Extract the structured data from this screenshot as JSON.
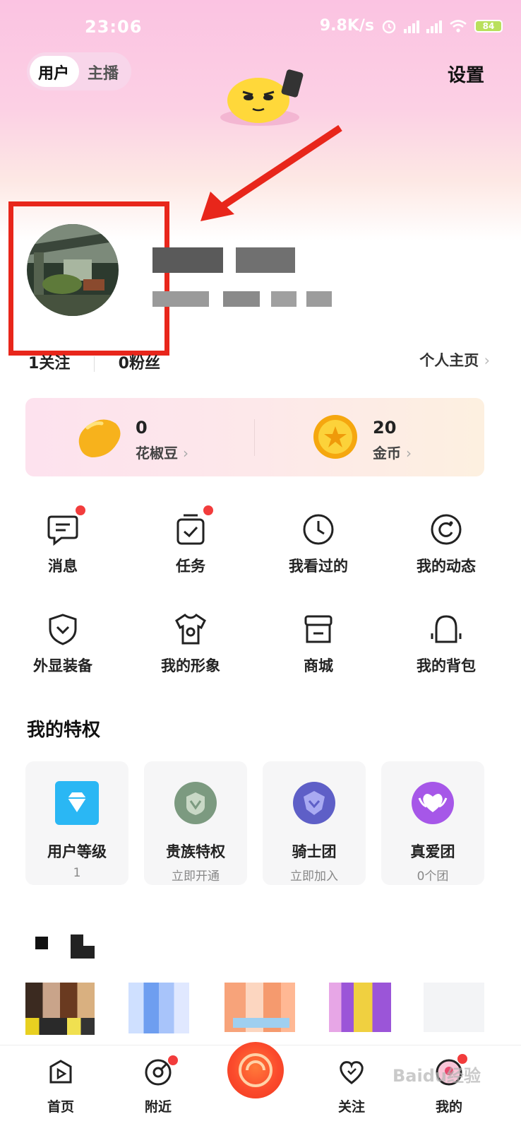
{
  "status_bar": {
    "time": "23:06",
    "net_speed": "9.8K/s",
    "battery": "84"
  },
  "header": {
    "tabs": [
      "用户",
      "主播"
    ],
    "settings_label": "设置"
  },
  "profile": {
    "following_count": "1",
    "following_label": "关注",
    "fans_count": "0",
    "fans_label": "粉丝",
    "homepage_link": "个人主页"
  },
  "wallet": {
    "peppers": {
      "value": "0",
      "label": "花椒豆"
    },
    "coins": {
      "value": "20",
      "label": "金币"
    }
  },
  "shortcuts": [
    {
      "label": "消息",
      "icon": "message-icon",
      "badge": true
    },
    {
      "label": "任务",
      "icon": "task-icon",
      "badge": true
    },
    {
      "label": "我看过的",
      "icon": "history-clock-icon",
      "badge": false
    },
    {
      "label": "我的动态",
      "icon": "moments-icon",
      "badge": false
    },
    {
      "label": "外显装备",
      "icon": "shield-icon",
      "badge": false
    },
    {
      "label": "我的形象",
      "icon": "tshirt-icon",
      "badge": false
    },
    {
      "label": "商城",
      "icon": "shop-icon",
      "badge": false
    },
    {
      "label": "我的背包",
      "icon": "backpack-icon",
      "badge": false
    }
  ],
  "privileges": {
    "title": "我的特权",
    "items": [
      {
        "title": "用户等级",
        "sub": "1",
        "icon": "diamond-icon",
        "color": "#2ab7f4"
      },
      {
        "title": "贵族特权",
        "sub": "立即开通",
        "icon": "noble-badge-icon",
        "color": "#7c9a80"
      },
      {
        "title": "骑士团",
        "sub": "立即加入",
        "icon": "knight-badge-icon",
        "color": "#5e5fc7"
      },
      {
        "title": "真爱团",
        "sub": "0个团",
        "icon": "heart-badge-icon",
        "color": "#a657e8"
      }
    ]
  },
  "bottom_nav": [
    {
      "label": "首页",
      "icon": "home-play-icon"
    },
    {
      "label": "附近",
      "icon": "nearby-icon"
    },
    {
      "label": "关注",
      "icon": "heart-icon"
    },
    {
      "label": "我的",
      "icon": "profile-icon"
    }
  ],
  "watermark": "Baidu经验",
  "colors": {
    "accent": "#f0391f",
    "badge": "#f23c3c",
    "annotation": "#e8261b"
  }
}
